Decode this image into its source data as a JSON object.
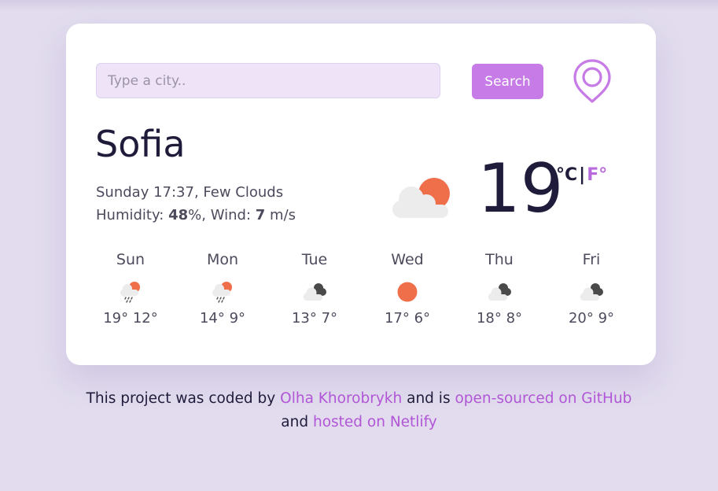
{
  "search": {
    "placeholder": "Type a city..",
    "value": "",
    "button_label": "Search"
  },
  "location_icon": "map-pin-icon",
  "current": {
    "city": "Sofia",
    "day_time": "Sunday 17:37",
    "description": "Few Clouds",
    "humidity_label": "Humidity:",
    "humidity_value": "48",
    "humidity_unit": "%",
    "wind_label": "Wind:",
    "wind_value": "7",
    "wind_unit": "m/s",
    "temperature": "19",
    "icon": "few-clouds-day-icon",
    "unit_celsius": "°C",
    "unit_separator": "|",
    "unit_fahrenheit": "F°"
  },
  "forecast": [
    {
      "day": "Sun",
      "max": "19°",
      "min": "12°",
      "icon": "rain-sun-icon"
    },
    {
      "day": "Mon",
      "max": "14°",
      "min": "9°",
      "icon": "rain-sun-icon"
    },
    {
      "day": "Tue",
      "max": "13°",
      "min": "7°",
      "icon": "broken-clouds-icon"
    },
    {
      "day": "Wed",
      "max": "17°",
      "min": "6°",
      "icon": "sun-icon"
    },
    {
      "day": "Thu",
      "max": "18°",
      "min": "8°",
      "icon": "broken-clouds-icon"
    },
    {
      "day": "Fri",
      "max": "20°",
      "min": "9°",
      "icon": "broken-clouds-icon"
    }
  ],
  "footer": {
    "text1": "This project was coded by",
    "author_link": "Olha Khorobrykh",
    "text2": "and is",
    "github_link": "open-sourced on GitHub",
    "text3": "and",
    "netlify_link": "hosted on Netlify"
  },
  "colors": {
    "accent": "#c67be6",
    "link": "#b156d6",
    "background": "#e2dcee",
    "sun": "#ef6f4b",
    "cloud_light": "#ececec",
    "cloud_dark": "#4a4a4a"
  }
}
